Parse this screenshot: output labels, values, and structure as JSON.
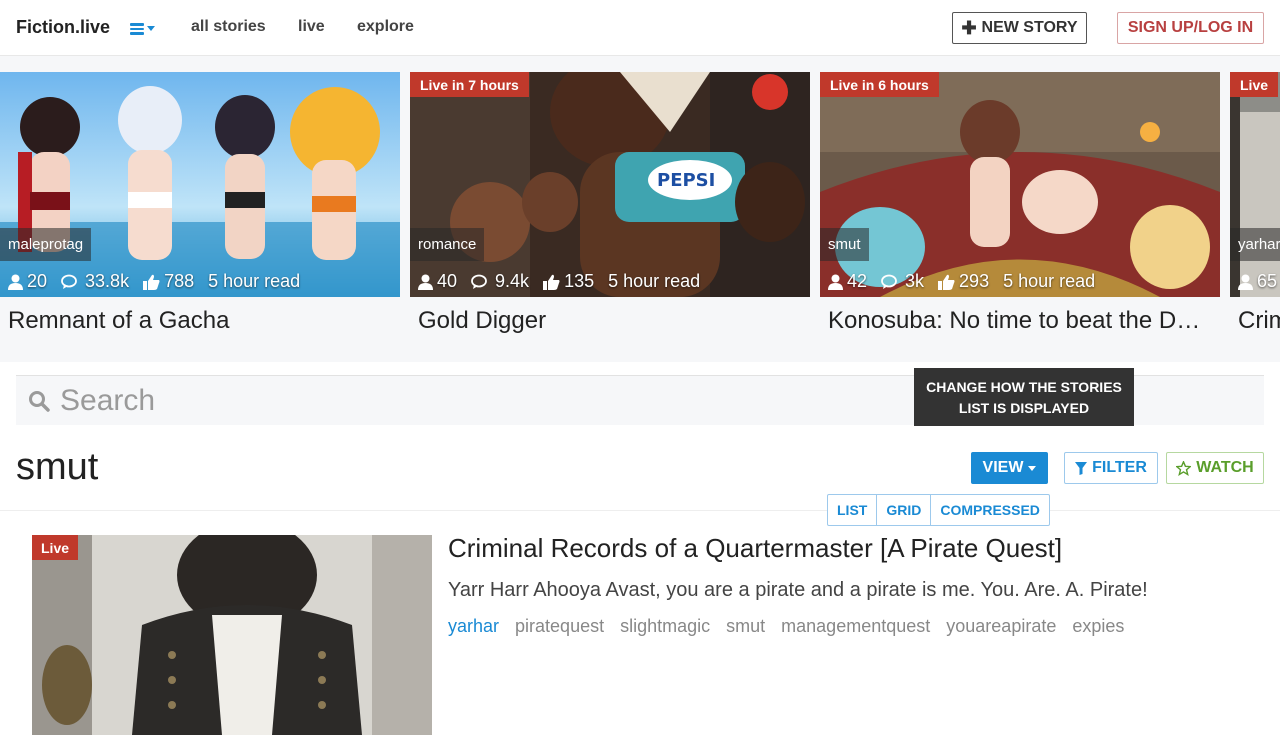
{
  "nav": {
    "brand": "Fiction.live",
    "links": [
      "all stories",
      "live",
      "explore"
    ],
    "new_story": "NEW STORY",
    "signup": "SIGN UP/LOG IN"
  },
  "carousel": [
    {
      "live": "",
      "tag": "maleprotag",
      "followers": "20",
      "comments": "33.8k",
      "likes": "788",
      "read": "5 hour read",
      "title": "Remnant of a Gacha"
    },
    {
      "live": "Live in 7 hours",
      "tag": "romance",
      "followers": "40",
      "comments": "9.4k",
      "likes": "135",
      "read": "5 hour read",
      "title": "Gold Digger"
    },
    {
      "live": "Live in 6 hours",
      "tag": "smut",
      "followers": "42",
      "comments": "3k",
      "likes": "293",
      "read": "5 hour read",
      "title": "Konosuba: No time to beat the Demon King"
    },
    {
      "live": "Live",
      "tag": "yarhar",
      "followers": "65",
      "comments": "",
      "likes": "",
      "read": "",
      "title": "Criminal Records of a Quartermaster"
    }
  ],
  "search": {
    "placeholder": "Search"
  },
  "tooltip": "CHANGE HOW THE STORIES LIST IS DISPLAYED",
  "section": {
    "title": "smut",
    "view": "VIEW",
    "filter": "FILTER",
    "watch": "WATCH",
    "view_options": [
      "LIST",
      "GRID",
      "COMPRESSED"
    ]
  },
  "story": {
    "live": "Live",
    "title": "Criminal Records of a Quartermaster [A Pirate Quest]",
    "description": "Yarr Harr Ahooya Avast, you are a pirate and a pirate is me. You. Are. A. Pirate!",
    "tags": [
      "yarhar",
      "piratequest",
      "slightmagic",
      "smut",
      "managementquest",
      "youareapirate",
      "expies"
    ]
  },
  "colors": {
    "accent": "#1a8ad4",
    "live": "#c0392b",
    "watch": "#5a9e2b",
    "signup": "#b84040"
  }
}
